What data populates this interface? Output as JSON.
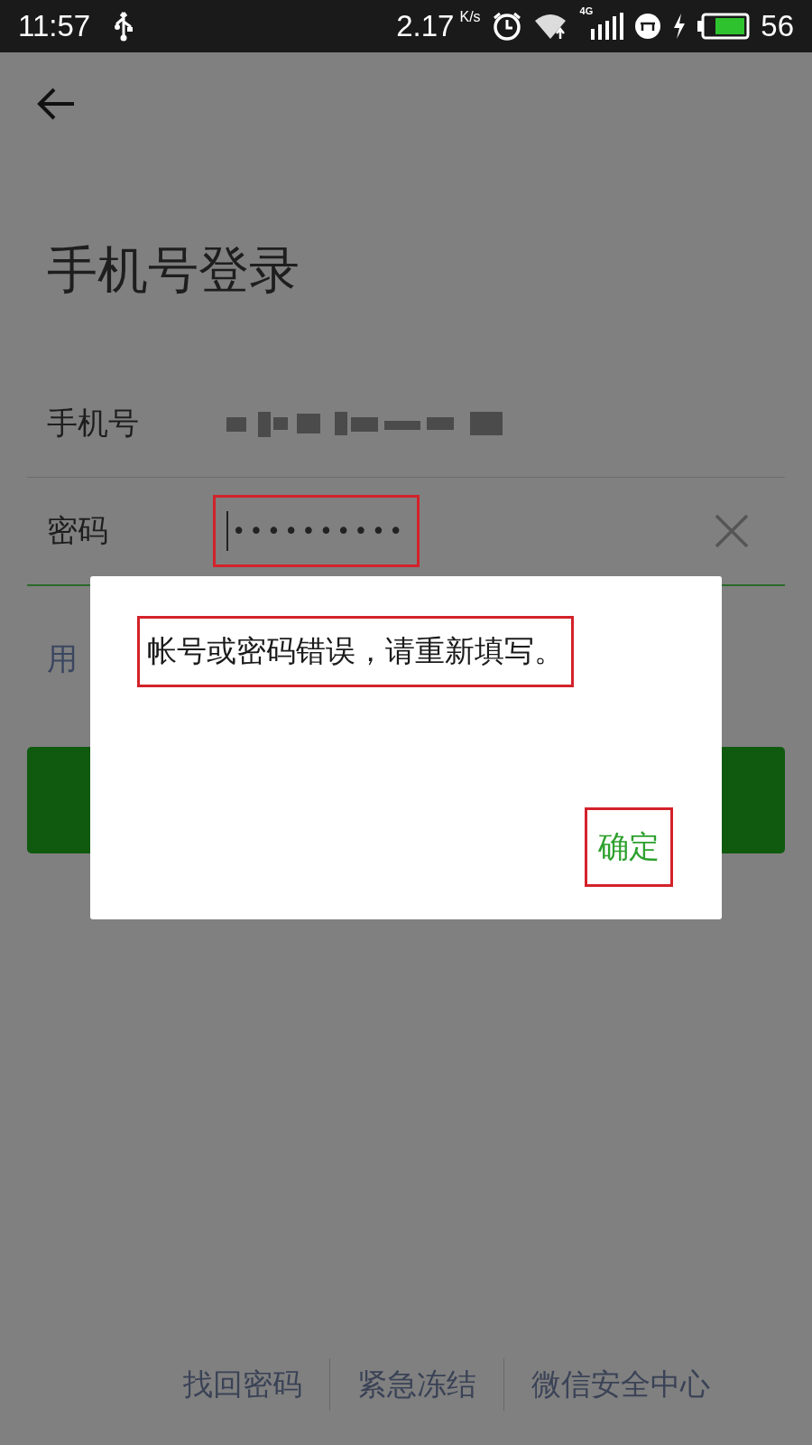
{
  "status_bar": {
    "time": "11:57",
    "speed": "2.17",
    "speed_unit": "K/s",
    "network": "4G",
    "battery": "56"
  },
  "title": "手机号登录",
  "form": {
    "rows": [
      {
        "kind": "phone",
        "label": "手机号",
        "highlighted": false
      },
      {
        "kind": "password",
        "label": "密码",
        "value": "••••••••••",
        "highlighted": true
      }
    ]
  },
  "alt_login_link": "用",
  "dialog": {
    "message": "帐号或密码错误，请重新填写。",
    "message_highlighted": true,
    "button": "确定",
    "button_highlighted": true
  },
  "footer_links": [
    "找回密码",
    "紧急冻结",
    "微信安全中心"
  ]
}
